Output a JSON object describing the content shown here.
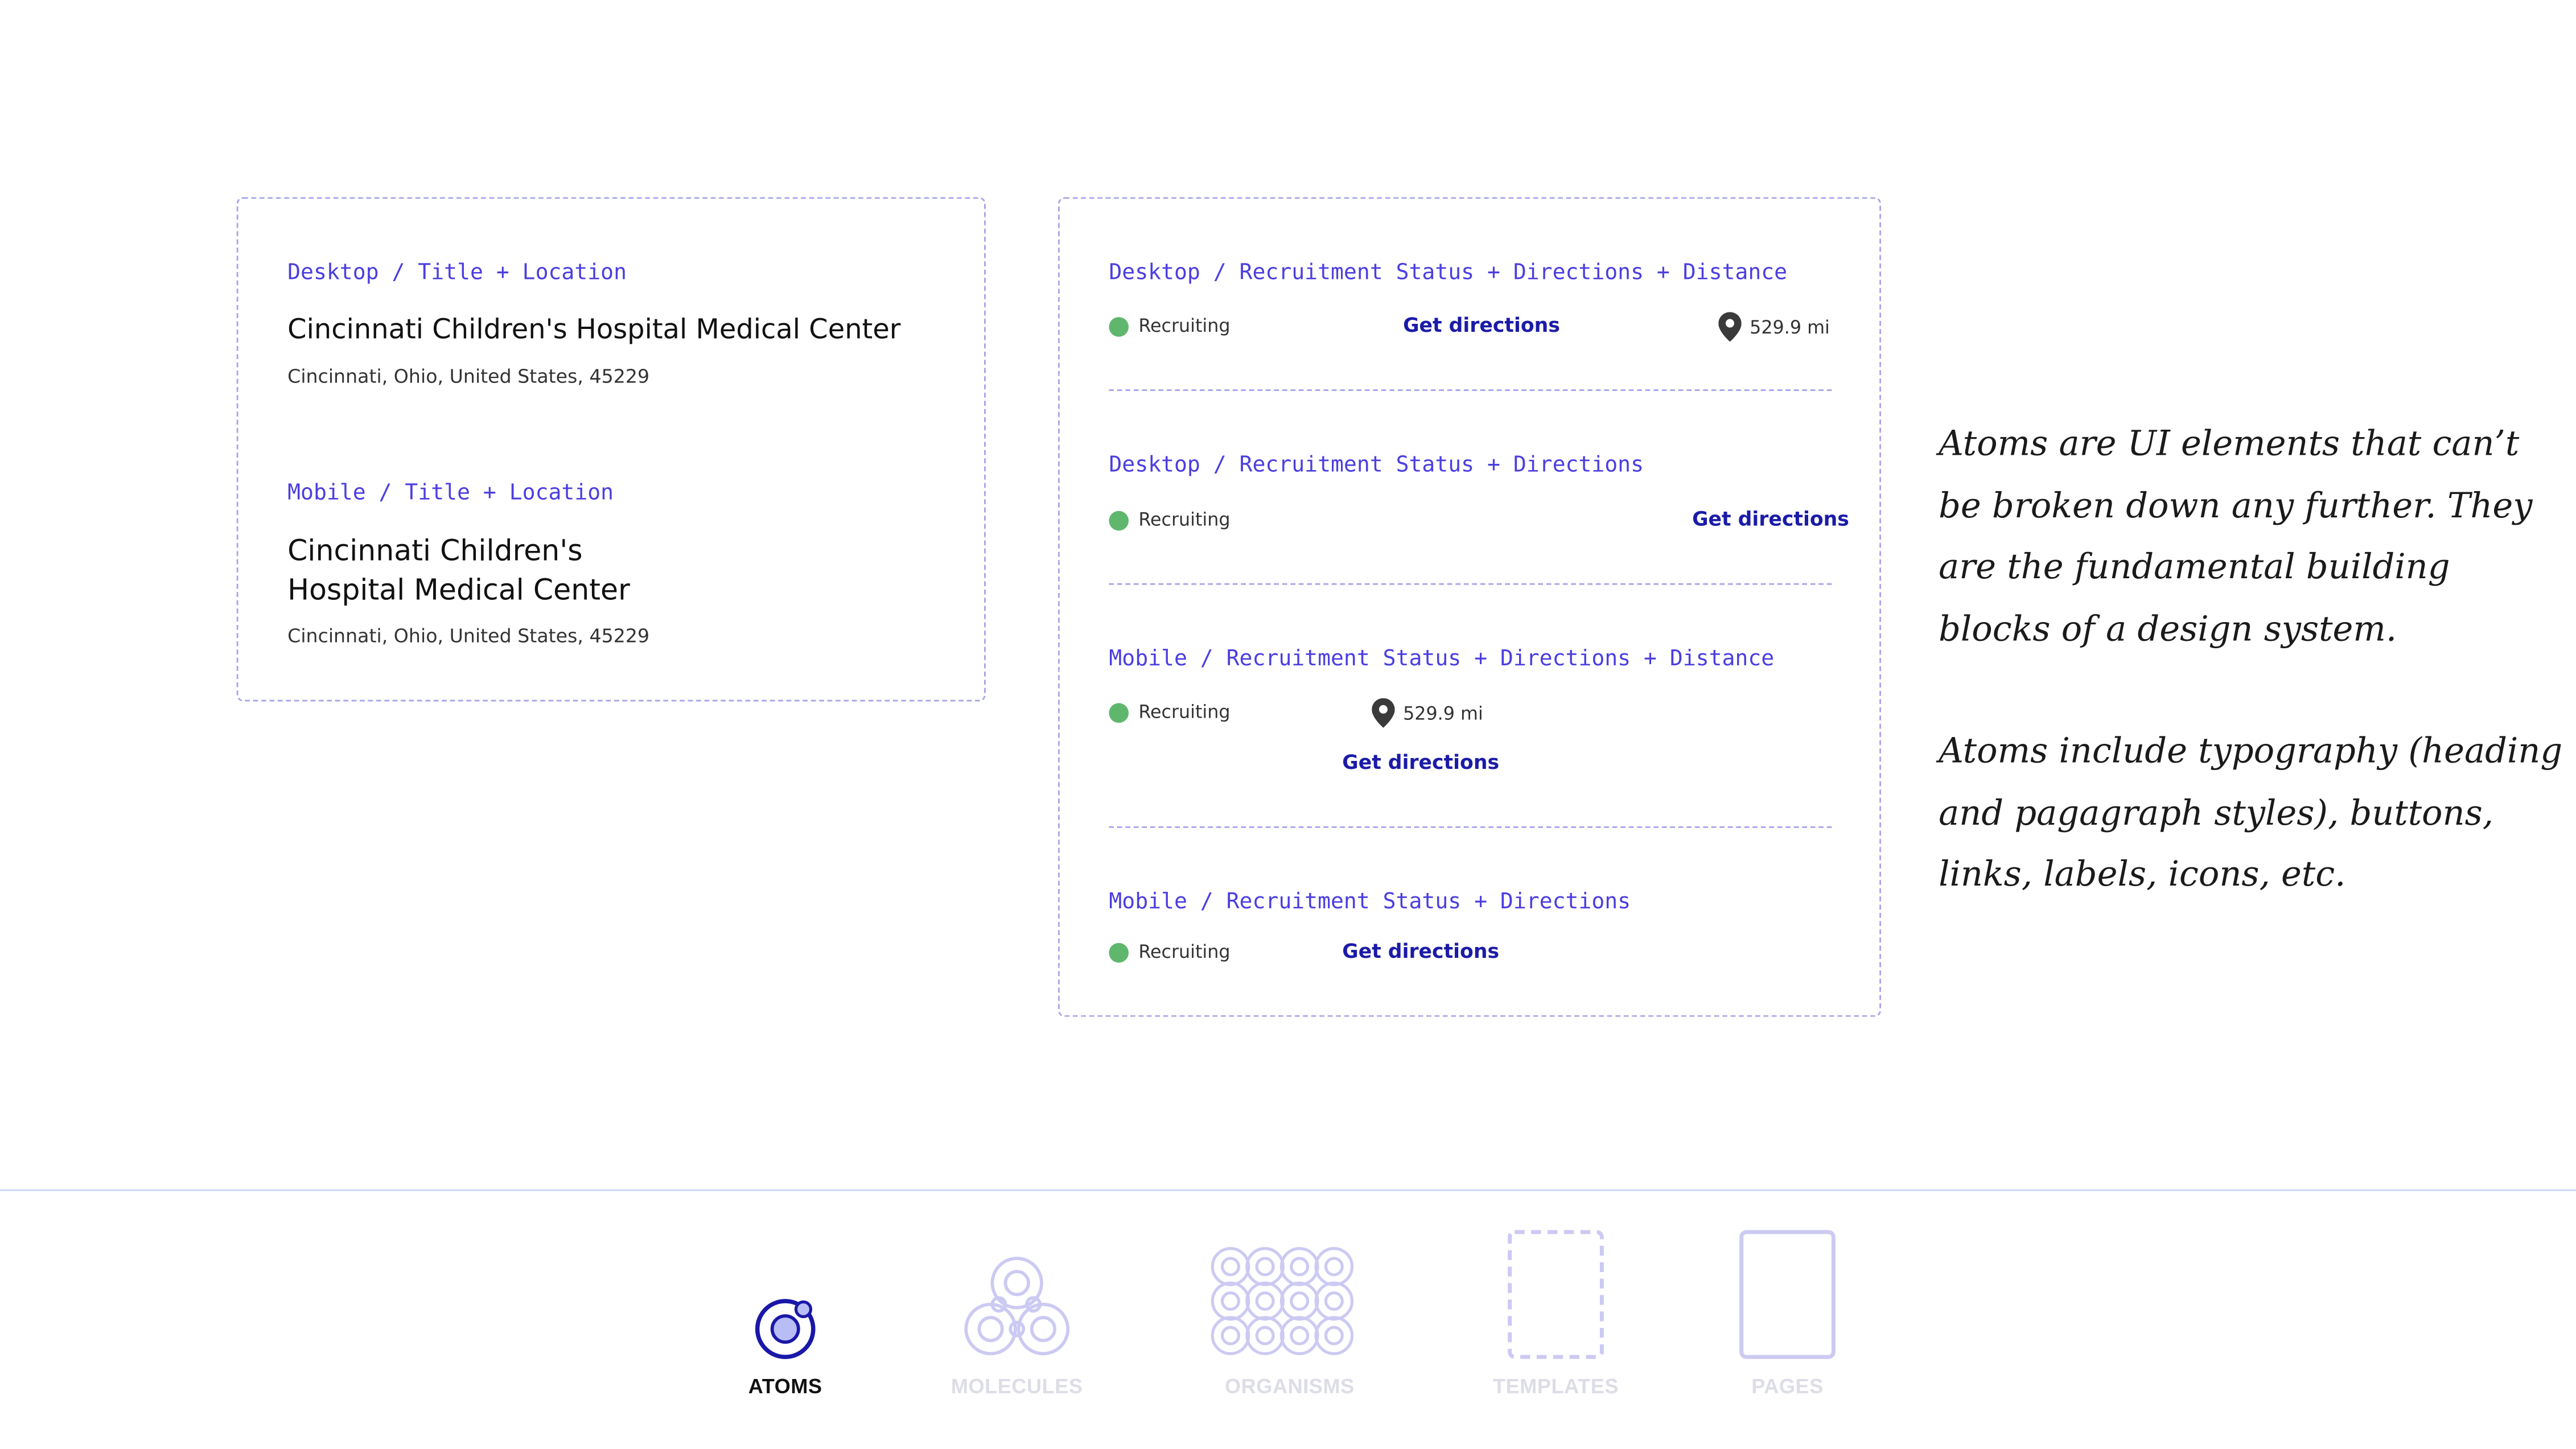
{
  "left_card": {
    "desktop_label": "Desktop / Title + Location",
    "desktop_title": "Cincinnati Children's Hospital Medical Center",
    "desktop_address": "Cincinnati, Ohio, United States, 45229",
    "mobile_label": "Mobile / Title + Location",
    "mobile_title_line1": "Cincinnati Children's",
    "mobile_title_line2": "Hospital Medical Center",
    "mobile_address": "Cincinnati, Ohio, United States, 45229"
  },
  "right_card": {
    "section1_label": "Desktop / Recruitment Status + Directions + Distance",
    "section2_label": "Desktop / Recruitment Status + Directions",
    "section3_label": "Mobile / Recruitment Status + Directions + Distance",
    "section4_label": "Mobile / Recruitment Status + Directions",
    "status_text": "Recruiting",
    "directions_text": "Get directions",
    "distance_text": "529.9 mi"
  },
  "note": {
    "paragraph1": "Atoms are UI elements that can’t be broken down any further. They are the fundamental building blocks of a design system.",
    "paragraph2": "Atoms include typography (heading and pagagraph styles), buttons, links, labels, icons, etc."
  },
  "nav": {
    "atoms": "ATOMS",
    "molecules": "MOLECULES",
    "organisms": "ORGANISMS",
    "templates": "TEMPLATES",
    "pages": "PAGES"
  },
  "colors": {
    "accent": "#4b3ee0",
    "link": "#1b1ba8",
    "status_green": "#5fb76d",
    "dashed_border": "#a8a4ea",
    "inactive_nav": "#dcdde6"
  }
}
